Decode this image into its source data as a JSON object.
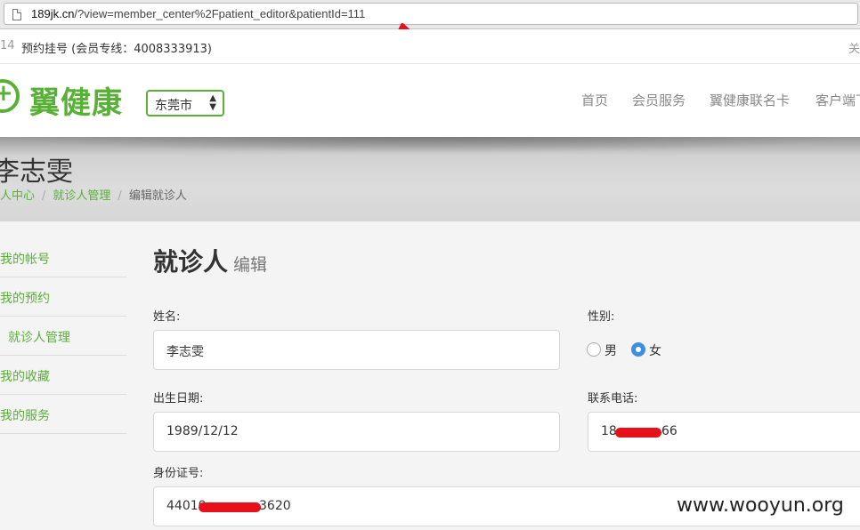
{
  "browser": {
    "url_host": "189jk.cn",
    "url_rest": "/?view=member_center%2Fpatient_editor&patientId=111"
  },
  "topbar": {
    "left_num": "14",
    "info": "预约挂号 (会员专线：4008333913)",
    "right": "关"
  },
  "header": {
    "logo_text": "翼健康",
    "city": "东莞市",
    "nav": [
      "首页",
      "会员服务",
      "翼健康联名卡",
      "客户端下"
    ]
  },
  "banner": {
    "title": "李志雯",
    "breadcrumb": [
      "人中心",
      "就诊人管理",
      "编辑就诊人"
    ]
  },
  "sidebar": {
    "items": [
      "我的帐号",
      "我的预约",
      "就诊人管理",
      "我的收藏",
      "我的服务"
    ]
  },
  "form": {
    "heading": "就诊人",
    "heading_sub": "编辑",
    "name_label": "姓名:",
    "name_value": "李志雯",
    "gender_label": "性别:",
    "gender_male": "男",
    "gender_female": "女",
    "birth_label": "出生日期:",
    "birth_value": "1989/12/12",
    "phone_label": "联系电话:",
    "phone_prefix": "18",
    "phone_suffix": "66",
    "id_label": "身份证号:",
    "id_prefix": "44010",
    "id_suffix": "3620"
  },
  "annotation_color": "#e8101a",
  "accent_color": "#59b037",
  "watermark": "www.wooyun.org"
}
